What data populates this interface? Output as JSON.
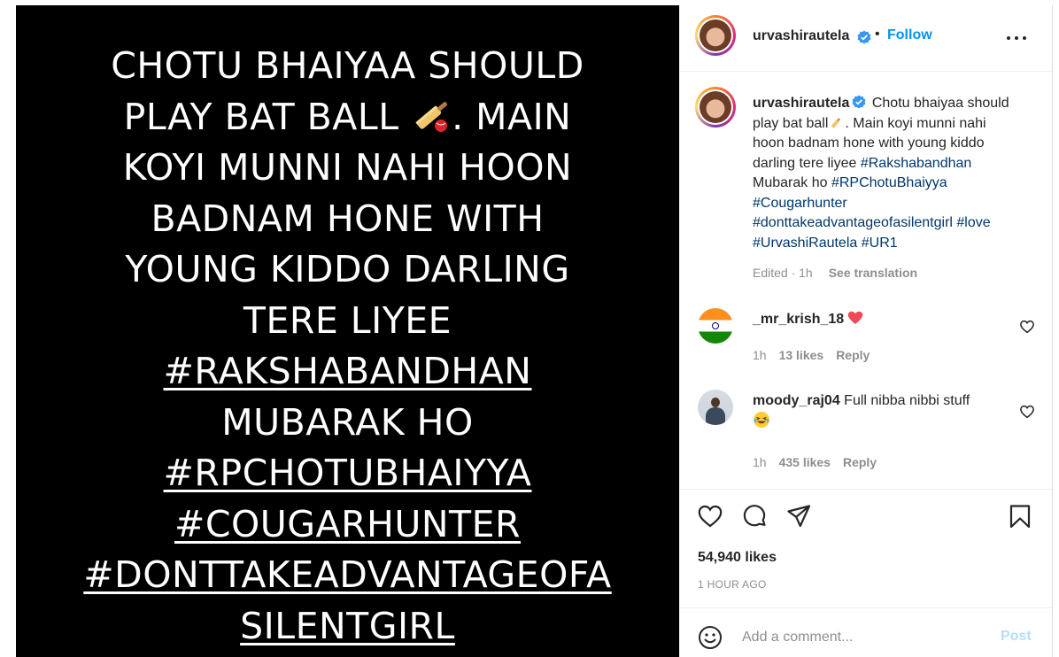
{
  "post": {
    "image_text": {
      "line1": "CHOTU BHAIYAA SHOULD",
      "line2a": "PLAY BAT BALL",
      "line2b": ". MAIN",
      "line3": "KOYI MUNNI NAHI HOON",
      "line4": "BADNAM HONE WITH",
      "line5": "YOUNG KIDDO DARLING",
      "line6": "TERE LIYEE",
      "line7": "#RAKSHABANDHAN",
      "line8": "MUBARAK HO",
      "line9": "#RPCHOTUBHAIYYA",
      "line10": "#COUGARHUNTER",
      "line11": "#DONTTAKEADVANTAGEOFA",
      "line12": "SILENTGIRL"
    }
  },
  "header": {
    "username": "urvashirautela",
    "dot": "•",
    "follow_label": "Follow"
  },
  "caption": {
    "username": "urvashirautela",
    "text_a": " Chotu bhaiyaa should play bat ball",
    "text_b": ". Main koyi munni nahi hoon badnam hone with young kiddo darling tere liyee ",
    "tag1": "#Rakshabandhan",
    "text_c": " Mubarak ho ",
    "tag2": "#RPChotuBhaiyya",
    "tag3": "#Cougarhunter",
    "tag4": "#donttakeadvantageofasilentgirl",
    "tag5": "#love",
    "tag6": "#UrvashiRautela",
    "tag7": "#UR1",
    "edited": "Edited · 1h",
    "see_translation": "See translation"
  },
  "comments": [
    {
      "username": "_mr_krish_18",
      "text": "",
      "time": "1h",
      "likes": "13 likes",
      "reply": "Reply"
    },
    {
      "username": "moody_raj04",
      "text": "Full nibba nibbi stuff",
      "time": "1h",
      "likes": "435 likes",
      "reply": "Reply"
    }
  ],
  "stats": {
    "likes": "54,940 likes",
    "time": "1 HOUR AGO"
  },
  "add_comment": {
    "placeholder": "Add a comment...",
    "post_label": "Post"
  },
  "colors": {
    "follow": "#0095f6",
    "hashtag": "#00376b",
    "post_disabled": "#b2dffc",
    "verified": "#3897f0",
    "heart": "#ed4956"
  },
  "icons": [
    "verified-badge-icon",
    "more-options-icon",
    "heart-icon",
    "comment-icon",
    "share-icon",
    "bookmark-icon",
    "emoji-icon",
    "cricket-bat-icon",
    "red-heart-emoji-icon",
    "laughing-emoji-icon"
  ]
}
